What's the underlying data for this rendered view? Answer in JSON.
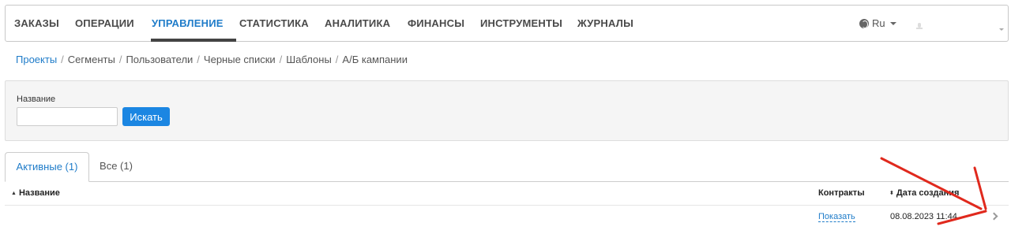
{
  "topnav": {
    "items": [
      {
        "label": "ЗАКАЗЫ",
        "active": false
      },
      {
        "label": "ОПЕРАЦИИ",
        "active": false
      },
      {
        "label": "УПРАВЛЕНИЕ",
        "active": true
      },
      {
        "label": "СТАТИСТИКА",
        "active": false
      },
      {
        "label": "АНАЛИТИКА",
        "active": false
      },
      {
        "label": "ФИНАНСЫ",
        "active": false
      },
      {
        "label": "ИНСТРУМЕНТЫ",
        "active": false
      },
      {
        "label": "ЖУРНАЛЫ",
        "active": false
      }
    ],
    "language": "Ru",
    "language_icon": "globe-icon",
    "user_icon": "user-icon"
  },
  "breadcrumb": {
    "items": [
      "Проекты",
      "Сегменты",
      "Пользователи",
      "Черные списки",
      "Шаблоны",
      "А/Б кампании"
    ]
  },
  "filter": {
    "label": "Название",
    "input_value": "",
    "search_button": "Искать"
  },
  "tabs": {
    "active": "Активные (1)",
    "all": "Все (1)"
  },
  "table": {
    "columns": {
      "name": "Название",
      "contracts": "Контракты",
      "created": "Дата создания"
    },
    "rows": [
      {
        "name": "",
        "contracts": "Показать",
        "created": "08.08.2023 11:44"
      }
    ]
  },
  "colors": {
    "accent": "#1f7cc9",
    "button": "#1b86e2",
    "annotation_arrow": "#e0291d"
  }
}
